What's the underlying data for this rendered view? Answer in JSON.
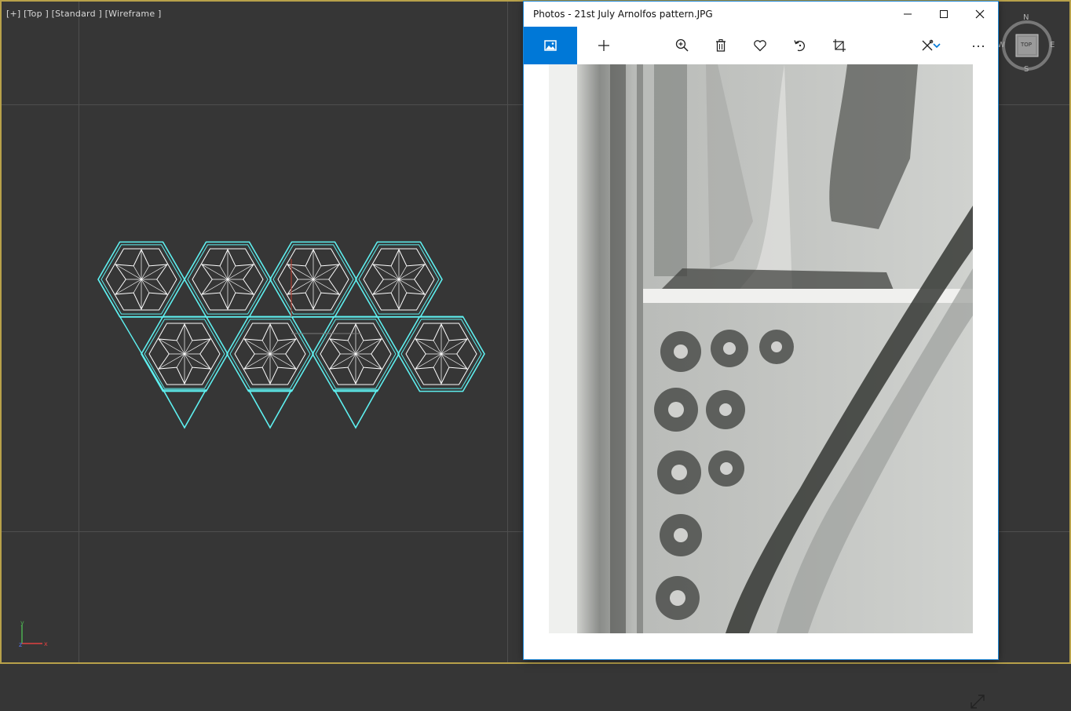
{
  "viewport": {
    "label": "[+] [Top ] [Standard ] [Wireframe ]",
    "wire_color": "#5ef0f0",
    "star_color": "#ffffff",
    "axis": {
      "y": "y",
      "x": "x",
      "z": "z"
    }
  },
  "viewcube": {
    "north": "N",
    "south": "S",
    "east": "E",
    "west": "W",
    "face": "TOP"
  },
  "photos_window": {
    "title": "Photos - 21st July Arnolfos pattern.JPG",
    "controls": {
      "minimize": "—",
      "maximize": "☐",
      "close": "✕"
    },
    "toolbar": {
      "items": [
        "view-icon",
        "add-icon",
        "zoom-icon",
        "delete-icon",
        "favorite-icon",
        "rotate-icon",
        "crop-icon",
        "edit-draw-icon",
        "more-icon"
      ],
      "more_label": "···",
      "accent": "#0078d7"
    }
  }
}
